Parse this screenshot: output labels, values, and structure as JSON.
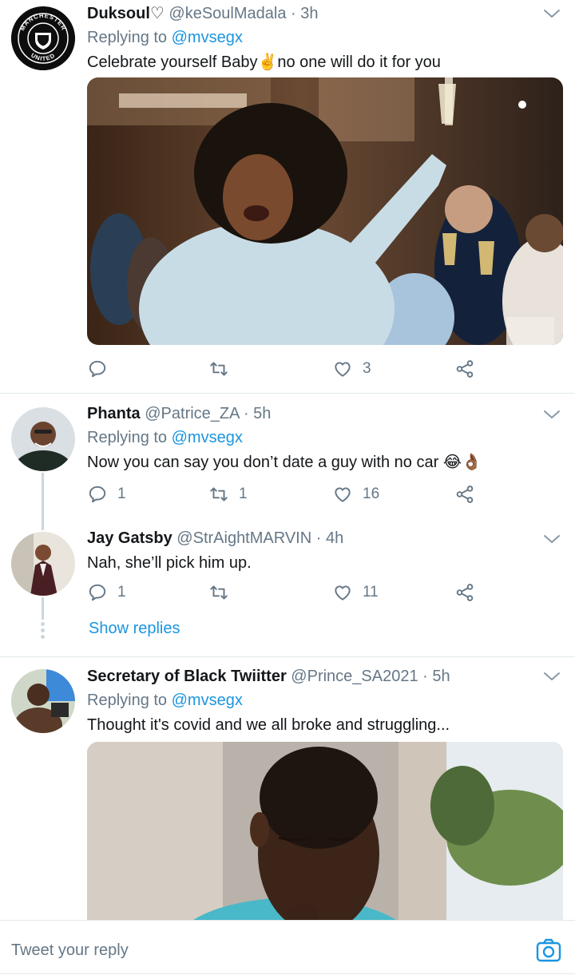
{
  "tweets": [
    {
      "name": "Duksoul♡",
      "handle": "@keSoulMadala",
      "time": "· 3h",
      "replying_prefix": "Replying to",
      "replying_to": "@mvsegx",
      "text": "Celebrate yourself Baby✌️no one will do it for you",
      "avatar_icon": "manchester-united-crest",
      "avatar_text": [
        "MANCHESTER",
        "UNITED"
      ],
      "media": "photo-woman-raising-champagne-glass",
      "actions": {
        "reply": "",
        "retweet": "",
        "like": "3"
      }
    },
    {
      "name": "Phanta",
      "handle": "@Patrice_ZA",
      "time": "· 5h",
      "replying_prefix": "Replying to",
      "replying_to": "@mvsegx",
      "text": "Now you can say you don’t date a guy with no car 😂👌🏾",
      "actions": {
        "reply": "1",
        "retweet": "1",
        "like": "16"
      }
    },
    {
      "name": "Jay Gatsby",
      "handle": "@StrAightMARVIN",
      "time": "· 4h",
      "text": "Nah, she’ll pick him up.",
      "actions": {
        "reply": "1",
        "retweet": "",
        "like": "11"
      }
    },
    {
      "name": "Secretary of Black Twiitter",
      "handle": "@Prince_SA2021",
      "time": "· 5h",
      "replying_prefix": "Replying to",
      "replying_to": "@mvsegx",
      "text": "Thought it's covid and we all broke and struggling...",
      "media": "photo-boy-looking-down"
    }
  ],
  "show_replies": "Show replies",
  "composer": {
    "placeholder": "Tweet your reply",
    "icon": "camera-icon"
  },
  "colors": {
    "link": "#1b95e0",
    "muted": "#657786",
    "divider": "#e1e8ed"
  }
}
